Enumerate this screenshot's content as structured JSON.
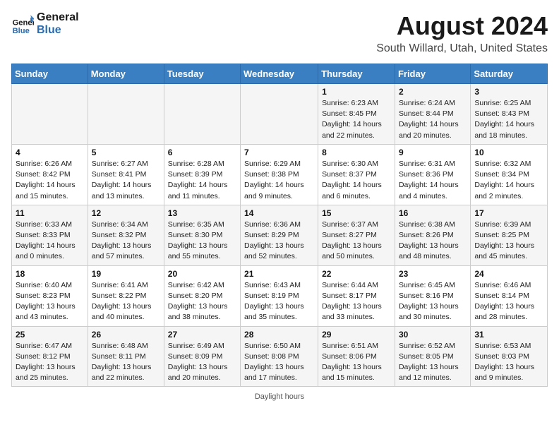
{
  "header": {
    "logo_line1": "General",
    "logo_line2": "Blue",
    "title": "August 2024",
    "subtitle": "South Willard, Utah, United States"
  },
  "days_of_week": [
    "Sunday",
    "Monday",
    "Tuesday",
    "Wednesday",
    "Thursday",
    "Friday",
    "Saturday"
  ],
  "weeks": [
    [
      {
        "day": "",
        "sunrise": "",
        "sunset": "",
        "daylight": ""
      },
      {
        "day": "",
        "sunrise": "",
        "sunset": "",
        "daylight": ""
      },
      {
        "day": "",
        "sunrise": "",
        "sunset": "",
        "daylight": ""
      },
      {
        "day": "",
        "sunrise": "",
        "sunset": "",
        "daylight": ""
      },
      {
        "day": "1",
        "sunrise": "Sunrise: 6:23 AM",
        "sunset": "Sunset: 8:45 PM",
        "daylight": "Daylight: 14 hours and 22 minutes."
      },
      {
        "day": "2",
        "sunrise": "Sunrise: 6:24 AM",
        "sunset": "Sunset: 8:44 PM",
        "daylight": "Daylight: 14 hours and 20 minutes."
      },
      {
        "day": "3",
        "sunrise": "Sunrise: 6:25 AM",
        "sunset": "Sunset: 8:43 PM",
        "daylight": "Daylight: 14 hours and 18 minutes."
      }
    ],
    [
      {
        "day": "4",
        "sunrise": "Sunrise: 6:26 AM",
        "sunset": "Sunset: 8:42 PM",
        "daylight": "Daylight: 14 hours and 15 minutes."
      },
      {
        "day": "5",
        "sunrise": "Sunrise: 6:27 AM",
        "sunset": "Sunset: 8:41 PM",
        "daylight": "Daylight: 14 hours and 13 minutes."
      },
      {
        "day": "6",
        "sunrise": "Sunrise: 6:28 AM",
        "sunset": "Sunset: 8:39 PM",
        "daylight": "Daylight: 14 hours and 11 minutes."
      },
      {
        "day": "7",
        "sunrise": "Sunrise: 6:29 AM",
        "sunset": "Sunset: 8:38 PM",
        "daylight": "Daylight: 14 hours and 9 minutes."
      },
      {
        "day": "8",
        "sunrise": "Sunrise: 6:30 AM",
        "sunset": "Sunset: 8:37 PM",
        "daylight": "Daylight: 14 hours and 6 minutes."
      },
      {
        "day": "9",
        "sunrise": "Sunrise: 6:31 AM",
        "sunset": "Sunset: 8:36 PM",
        "daylight": "Daylight: 14 hours and 4 minutes."
      },
      {
        "day": "10",
        "sunrise": "Sunrise: 6:32 AM",
        "sunset": "Sunset: 8:34 PM",
        "daylight": "Daylight: 14 hours and 2 minutes."
      }
    ],
    [
      {
        "day": "11",
        "sunrise": "Sunrise: 6:33 AM",
        "sunset": "Sunset: 8:33 PM",
        "daylight": "Daylight: 14 hours and 0 minutes."
      },
      {
        "day": "12",
        "sunrise": "Sunrise: 6:34 AM",
        "sunset": "Sunset: 8:32 PM",
        "daylight": "Daylight: 13 hours and 57 minutes."
      },
      {
        "day": "13",
        "sunrise": "Sunrise: 6:35 AM",
        "sunset": "Sunset: 8:30 PM",
        "daylight": "Daylight: 13 hours and 55 minutes."
      },
      {
        "day": "14",
        "sunrise": "Sunrise: 6:36 AM",
        "sunset": "Sunset: 8:29 PM",
        "daylight": "Daylight: 13 hours and 52 minutes."
      },
      {
        "day": "15",
        "sunrise": "Sunrise: 6:37 AM",
        "sunset": "Sunset: 8:27 PM",
        "daylight": "Daylight: 13 hours and 50 minutes."
      },
      {
        "day": "16",
        "sunrise": "Sunrise: 6:38 AM",
        "sunset": "Sunset: 8:26 PM",
        "daylight": "Daylight: 13 hours and 48 minutes."
      },
      {
        "day": "17",
        "sunrise": "Sunrise: 6:39 AM",
        "sunset": "Sunset: 8:25 PM",
        "daylight": "Daylight: 13 hours and 45 minutes."
      }
    ],
    [
      {
        "day": "18",
        "sunrise": "Sunrise: 6:40 AM",
        "sunset": "Sunset: 8:23 PM",
        "daylight": "Daylight: 13 hours and 43 minutes."
      },
      {
        "day": "19",
        "sunrise": "Sunrise: 6:41 AM",
        "sunset": "Sunset: 8:22 PM",
        "daylight": "Daylight: 13 hours and 40 minutes."
      },
      {
        "day": "20",
        "sunrise": "Sunrise: 6:42 AM",
        "sunset": "Sunset: 8:20 PM",
        "daylight": "Daylight: 13 hours and 38 minutes."
      },
      {
        "day": "21",
        "sunrise": "Sunrise: 6:43 AM",
        "sunset": "Sunset: 8:19 PM",
        "daylight": "Daylight: 13 hours and 35 minutes."
      },
      {
        "day": "22",
        "sunrise": "Sunrise: 6:44 AM",
        "sunset": "Sunset: 8:17 PM",
        "daylight": "Daylight: 13 hours and 33 minutes."
      },
      {
        "day": "23",
        "sunrise": "Sunrise: 6:45 AM",
        "sunset": "Sunset: 8:16 PM",
        "daylight": "Daylight: 13 hours and 30 minutes."
      },
      {
        "day": "24",
        "sunrise": "Sunrise: 6:46 AM",
        "sunset": "Sunset: 8:14 PM",
        "daylight": "Daylight: 13 hours and 28 minutes."
      }
    ],
    [
      {
        "day": "25",
        "sunrise": "Sunrise: 6:47 AM",
        "sunset": "Sunset: 8:12 PM",
        "daylight": "Daylight: 13 hours and 25 minutes."
      },
      {
        "day": "26",
        "sunrise": "Sunrise: 6:48 AM",
        "sunset": "Sunset: 8:11 PM",
        "daylight": "Daylight: 13 hours and 22 minutes."
      },
      {
        "day": "27",
        "sunrise": "Sunrise: 6:49 AM",
        "sunset": "Sunset: 8:09 PM",
        "daylight": "Daylight: 13 hours and 20 minutes."
      },
      {
        "day": "28",
        "sunrise": "Sunrise: 6:50 AM",
        "sunset": "Sunset: 8:08 PM",
        "daylight": "Daylight: 13 hours and 17 minutes."
      },
      {
        "day": "29",
        "sunrise": "Sunrise: 6:51 AM",
        "sunset": "Sunset: 8:06 PM",
        "daylight": "Daylight: 13 hours and 15 minutes."
      },
      {
        "day": "30",
        "sunrise": "Sunrise: 6:52 AM",
        "sunset": "Sunset: 8:05 PM",
        "daylight": "Daylight: 13 hours and 12 minutes."
      },
      {
        "day": "31",
        "sunrise": "Sunrise: 6:53 AM",
        "sunset": "Sunset: 8:03 PM",
        "daylight": "Daylight: 13 hours and 9 minutes."
      }
    ]
  ],
  "footer": "Daylight hours"
}
